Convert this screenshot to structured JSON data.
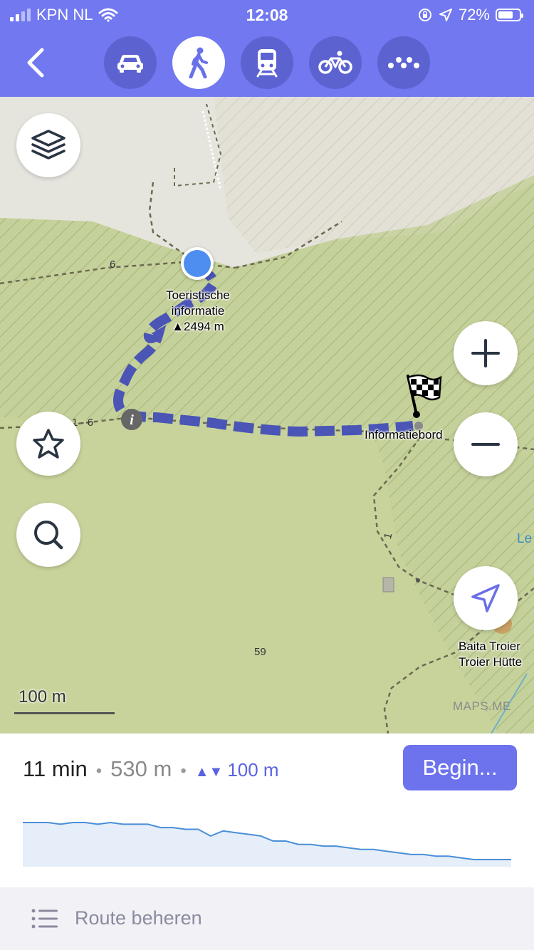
{
  "status_bar": {
    "carrier": "KPN NL",
    "time": "12:08",
    "battery": "72%",
    "battery_level": 0.72
  },
  "header": {
    "back_icon": "chevron-left-icon",
    "modes": [
      {
        "name": "car",
        "icon": "car-icon",
        "active": false
      },
      {
        "name": "walk",
        "icon": "pedestrian-icon",
        "active": true
      },
      {
        "name": "transit",
        "icon": "train-icon",
        "active": false
      },
      {
        "name": "bicycle",
        "icon": "bicycle-icon",
        "active": false
      },
      {
        "name": "taxi",
        "icon": "taxi-icon",
        "active": false
      }
    ],
    "accent_color": "#7178f0"
  },
  "map": {
    "start_label_line1": "Toeristische",
    "start_label_line2": "informatie",
    "start_label_elevation": "▲2494 m",
    "destination_label": "Informatiebord",
    "road_number_1": "6",
    "road_number_2": "1 - 6",
    "road_number_3": "1",
    "elevation_point": "59",
    "place_label_line1": "Baita Troier",
    "place_label_line2": "Troier Hütte",
    "water_label": "Le",
    "scale": "100 m",
    "watermark": "MAPS.ME",
    "route_color": "#4a55b5"
  },
  "controls": {
    "layers_icon": "layers-icon",
    "bookmarks_icon": "star-icon",
    "search_icon": "search-icon",
    "zoom_in_icon": "plus-icon",
    "zoom_out_icon": "minus-icon",
    "location_icon": "navigation-arrow-icon"
  },
  "route": {
    "time": "11 min",
    "distance": "530 m",
    "elevation": "100 m",
    "begin_label": "Begin...",
    "elevation_profile": [
      100,
      100,
      100,
      99,
      100,
      100,
      99,
      100,
      99,
      99,
      99,
      97,
      97,
      96,
      96,
      92,
      95,
      94,
      93,
      92,
      89,
      89,
      87,
      87,
      86,
      86,
      85,
      84,
      84,
      83,
      82,
      81,
      81,
      80,
      80,
      79,
      78,
      78,
      78,
      78
    ]
  },
  "footer": {
    "label": "Route beheren",
    "icon": "list-icon"
  }
}
